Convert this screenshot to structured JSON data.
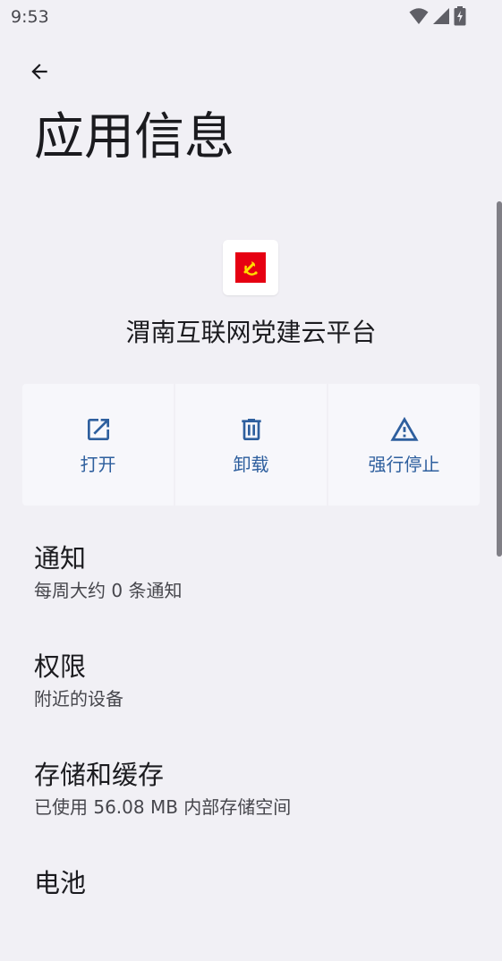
{
  "status_bar": {
    "time": "9:53"
  },
  "page": {
    "title": "应用信息"
  },
  "app": {
    "name": "渭南互联网党建云平台"
  },
  "actions": [
    {
      "label": "打开",
      "icon": "open-external-icon"
    },
    {
      "label": "卸载",
      "icon": "trash-icon"
    },
    {
      "label": "强行停止",
      "icon": "warning-icon"
    }
  ],
  "settings": [
    {
      "title": "通知",
      "summary": "每周大约 0 条通知"
    },
    {
      "title": "权限",
      "summary": "附近的设备"
    },
    {
      "title": "存储和缓存",
      "summary": "已使用 56.08 MB 内部存储空间"
    },
    {
      "title": "电池",
      "summary": ""
    }
  ],
  "colors": {
    "background": "#f1f0f5",
    "accent": "#2e5f9e",
    "app_icon_red": "#e60012"
  }
}
